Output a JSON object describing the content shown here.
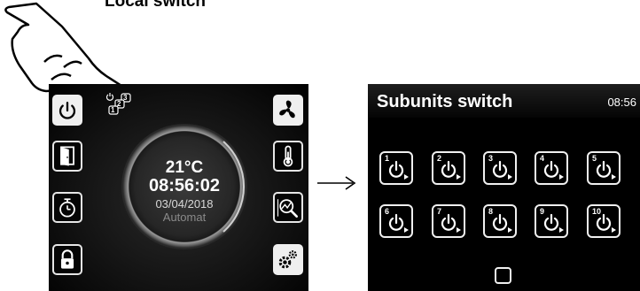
{
  "caption": "Local switch",
  "main_screen": {
    "left_buttons": [
      {
        "icon": "power-icon",
        "filled": true
      },
      {
        "icon": "door-icon",
        "filled": false
      },
      {
        "icon": "timer-icon",
        "filled": false
      },
      {
        "icon": "lock-icon",
        "filled": false
      }
    ],
    "right_buttons": [
      {
        "icon": "fan-icon",
        "filled": true
      },
      {
        "icon": "thermometer-icon",
        "filled": false
      },
      {
        "icon": "chart-magnifier-icon",
        "filled": false
      },
      {
        "icon": "gears-icon",
        "filled": true
      }
    ],
    "mini_icons": {
      "icon": "subunits-icon",
      "numbers": [
        "1",
        "2",
        "3"
      ]
    },
    "dial": {
      "temperature": "21°C",
      "time": "08:56:02",
      "date": "03/04/2018",
      "mode": "Automat"
    }
  },
  "subunits_screen": {
    "title": "Subunits switch",
    "time": "08:56",
    "units": [
      "1",
      "2",
      "3",
      "4",
      "5",
      "6",
      "7",
      "8",
      "9",
      "10"
    ],
    "home_button_icon": "square-icon"
  },
  "colors": {
    "screen_bg": "#000000",
    "icon_fg": "#ffffff",
    "border": "#e6e6e6"
  }
}
